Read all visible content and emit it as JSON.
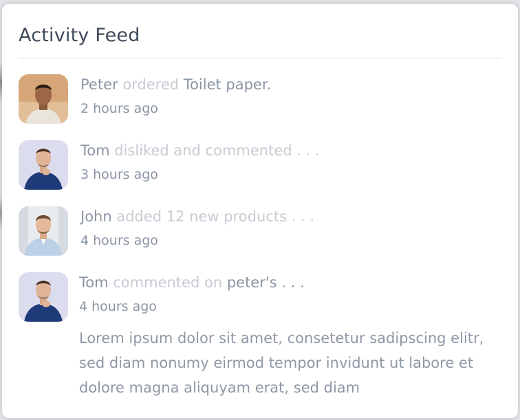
{
  "card": {
    "title": "Activity Feed"
  },
  "feed": {
    "items": [
      {
        "name": "Peter",
        "action": "ordered",
        "object": "Toilet paper.",
        "time": "2 hours ago",
        "avatar": "avatar-peter"
      },
      {
        "name": "Tom",
        "action": "disliked and commented . . .",
        "object": "",
        "time": "3 hours ago",
        "avatar": "avatar-tom"
      },
      {
        "name": "John",
        "action": "added 12 new products . . .",
        "object": "",
        "time": "4 hours ago",
        "avatar": "avatar-john"
      },
      {
        "name": "Tom",
        "action": "commented on",
        "object": "peter's . . .",
        "time": "4 hours ago",
        "avatar": "avatar-tom",
        "snippet": "Lorem ipsum dolor sit amet, consetetur sadipscing elitr, sed diam nonumy eirmod tempor invidunt ut labore et dolore magna aliquyam erat, sed diam"
      }
    ]
  },
  "colors": {
    "title": "#3f4a59",
    "name": "#8a94a3",
    "action": "#c6cbd3",
    "time": "#8a94a3",
    "divider": "#dcdde0"
  }
}
